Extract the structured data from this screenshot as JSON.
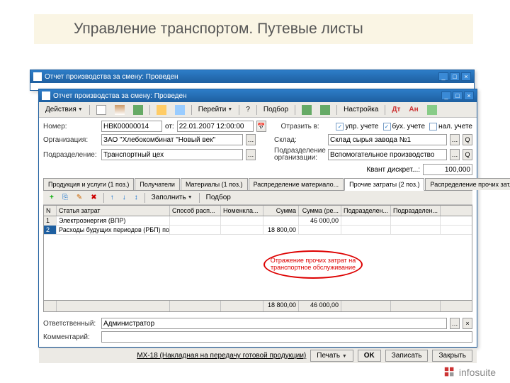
{
  "slide_title": "Управление транспортом. Путевые листы",
  "window_title": "Отчет производства за смену: Проведен",
  "toolbar": {
    "actions": "Действия",
    "goto": "Перейти",
    "podbor": "Подбор",
    "settings": "Настройка"
  },
  "form": {
    "num_lbl": "Номер:",
    "num_val": "НВК00000014",
    "ot_lbl": "от:",
    "date_val": "22.01.2007 12:00:00",
    "org_lbl": "Организация:",
    "org_val": "ЗАО \"Хлебокомбинат \"Новый век\"",
    "podr_lbl": "Подразделение:",
    "podr_val": "Транспортный цех",
    "otrazit_lbl": "Отразить в:",
    "chk_upr": "упр. учете",
    "chk_bux": "бух. учете",
    "chk_nal": "нал. учете",
    "sklad_lbl": "Склад:",
    "sklad_val": "Склад сырья завода №1",
    "podrorg_lbl": "Подразделение организации:",
    "podrorg_val": "Вспомогательное производство",
    "kvant_lbl": "Квант дискрет...:",
    "kvant_val": "100,000"
  },
  "tabs": {
    "t1": "Продукция и услуги (1 поз.)",
    "t2": "Получатели",
    "t3": "Материалы (1 поз.)",
    "t4": "Распределение материало...",
    "t5": "Прочие затраты (2 поз.)",
    "t6": "Распределение прочих зат..."
  },
  "subtb": {
    "fill": "Заполнить",
    "podbor": "Подбор"
  },
  "grid": {
    "h_n": "N",
    "h_stat": "Статья затрат",
    "h_sposob": "Способ расп...",
    "h_nomen": "Номенкла...",
    "h_sum": "Сумма",
    "h_sumre": "Сумма (ре...",
    "h_pod1": "Подразделен...",
    "h_pod2": "Подразделен...",
    "rows": [
      {
        "n": "1",
        "stat": "Электроэнергия (ВПР)",
        "sum": "",
        "sumre": "46 000,00"
      },
      {
        "n": "2",
        "stat": "Расходы будущих периодов (РБП) по страхованию",
        "sum": "18 800,00",
        "sumre": ""
      }
    ],
    "foot_sum": "18 800,00",
    "foot_sumre": "46 000,00"
  },
  "bottom": {
    "resp_lbl": "Ответственный:",
    "resp_val": "Администратор",
    "komm_lbl": "Комментарий:"
  },
  "bar": {
    "mx18": "МХ-18 (Накладная на передачу готовой продукции)",
    "pechat": "Печать",
    "ok": "OK",
    "zapisat": "Записать",
    "zakryt": "Закрыть"
  },
  "annot": "Отражение прочих затрат на транспортное обслуживание",
  "logo": "infosuite"
}
